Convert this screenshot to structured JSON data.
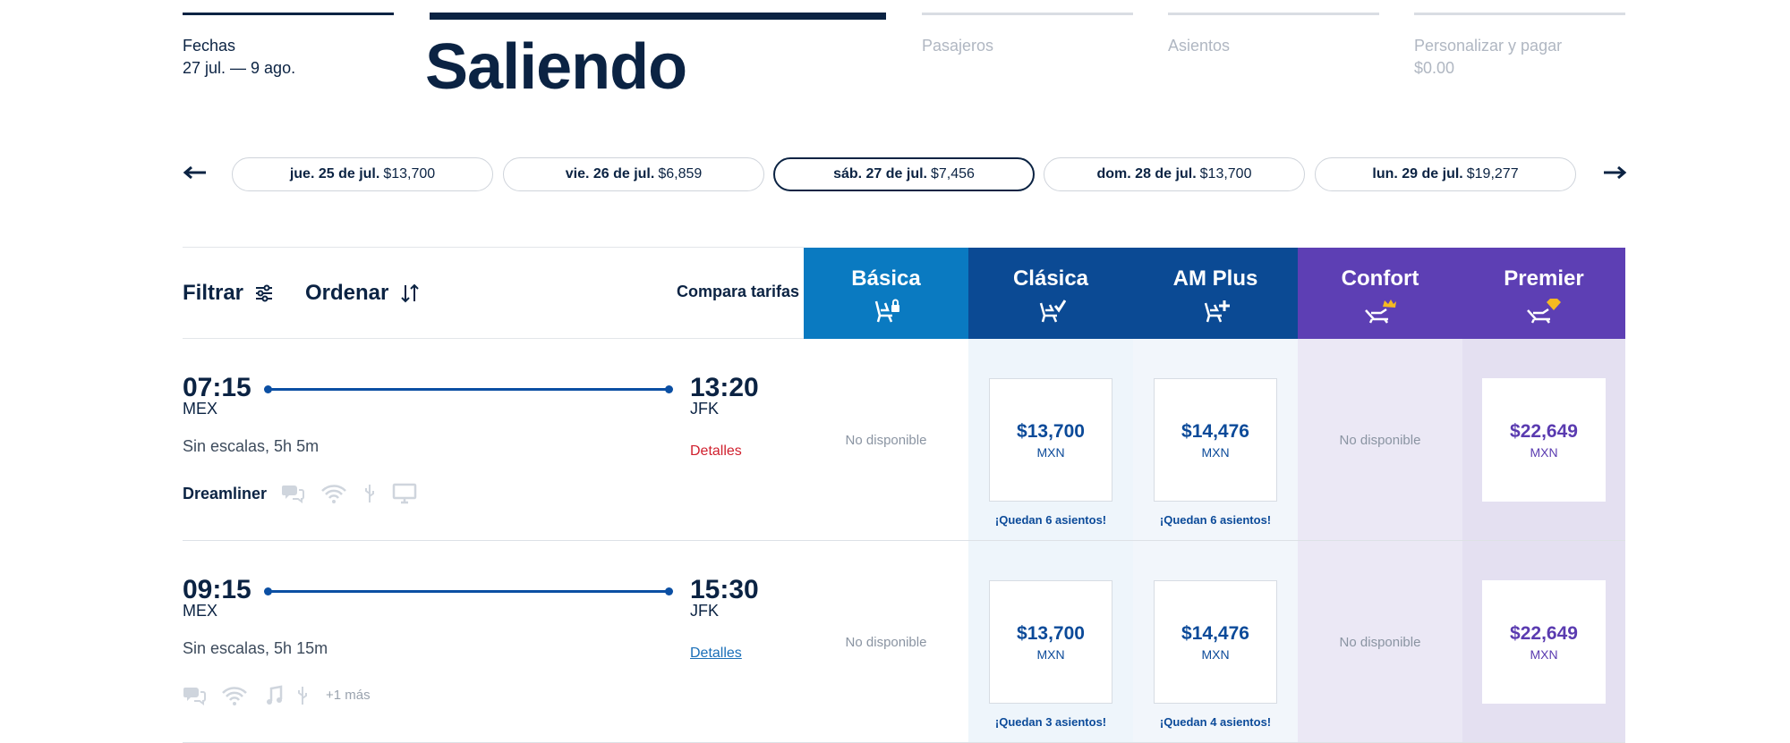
{
  "steps": [
    {
      "label": "Fechas",
      "sub": "27 jul. — 9 ago.",
      "state": "done"
    },
    {
      "label": "Saliendo",
      "state": "active"
    },
    {
      "label": "Pasajeros",
      "state": "pending"
    },
    {
      "label": "Asientos",
      "state": "pending"
    },
    {
      "label": "Personalizar y pagar",
      "sub": "$0.00",
      "state": "pending"
    }
  ],
  "dates": [
    {
      "day": "jue. 25 de jul.",
      "price": "$13,700"
    },
    {
      "day": "vie. 26 de jul.",
      "price": "$6,859"
    },
    {
      "day": "sáb. 27 de jul.",
      "price": "$7,456",
      "selected": true
    },
    {
      "day": "dom. 28 de jul.",
      "price": "$13,700"
    },
    {
      "day": "lun. 29 de jul.",
      "price": "$19,277"
    }
  ],
  "toolbar": {
    "filter": "Filtrar",
    "sort": "Ordenar",
    "compare": "Compara tarifas"
  },
  "fares": [
    {
      "name": "Básica",
      "color": "#0a7ac1",
      "icon": "seat-lock-icon"
    },
    {
      "name": "Clásica",
      "color": "#0b4a94",
      "icon": "seat-check-icon"
    },
    {
      "name": "AM Plus",
      "color": "#0b4a94",
      "icon": "seat-plus-icon"
    },
    {
      "name": "Confort",
      "color": "#5d3fb4",
      "icon": "seat-crown-icon"
    },
    {
      "name": "Premier",
      "color": "#5d3fb4",
      "icon": "seat-gem-icon"
    }
  ],
  "flights": [
    {
      "dep_time": "07:15",
      "dep_code": "MEX",
      "arr_time": "13:20",
      "arr_code": "JFK",
      "stops": "Sin escalas, 5h 5m",
      "details": "Detalles",
      "aircraft": "Dreamliner",
      "amenities": [
        "chat-icon",
        "wifi-icon",
        "usb-icon",
        "screen-icon"
      ],
      "basica": "No disponible",
      "clasica": {
        "price": "$13,700",
        "currency": "MXN",
        "left": "¡Quedan 6 asientos!"
      },
      "amplus": {
        "price": "$14,476",
        "currency": "MXN",
        "left": "¡Quedan 6 asientos!"
      },
      "confort": "No disponible",
      "premier": {
        "price": "$22,649",
        "currency": "MXN"
      }
    },
    {
      "dep_time": "09:15",
      "dep_code": "MEX",
      "arr_time": "15:30",
      "arr_code": "JFK",
      "stops": "Sin escalas, 5h 15m",
      "details": "Detalles",
      "amenities": [
        "chat-icon",
        "wifi-icon",
        "music-icon",
        "usb-icon"
      ],
      "more": "+1 más",
      "basica": "No disponible",
      "clasica": {
        "price": "$13,700",
        "currency": "MXN",
        "left": "¡Quedan 3 asientos!"
      },
      "amplus": {
        "price": "$14,476",
        "currency": "MXN",
        "left": "¡Quedan 4 asientos!"
      },
      "confort": "No disponible",
      "premier": {
        "price": "$22,649",
        "currency": "MXN"
      }
    }
  ]
}
